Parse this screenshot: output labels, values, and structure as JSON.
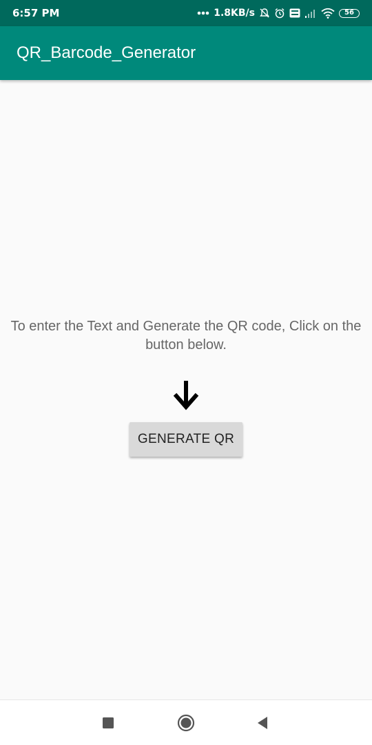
{
  "status_bar": {
    "time": "6:57 PM",
    "network_speed": "1.8KB/s",
    "battery_level": "56",
    "icons": [
      "dots-icon",
      "mute-bell-icon",
      "alarm-icon",
      "volte-icon",
      "signal-icon",
      "wifi-icon",
      "battery-icon"
    ]
  },
  "app_bar": {
    "title": "QR_Barcode_Generator",
    "color": "#00897b"
  },
  "main": {
    "instruction": "To enter the Text and Generate the QR code, Click on the button below.",
    "arrow_icon": "arrow-down-icon",
    "generate_button_label": "GENERATE QR"
  },
  "nav_bar": {
    "icons": [
      "recents-square-icon",
      "home-circle-icon",
      "back-triangle-icon"
    ]
  }
}
